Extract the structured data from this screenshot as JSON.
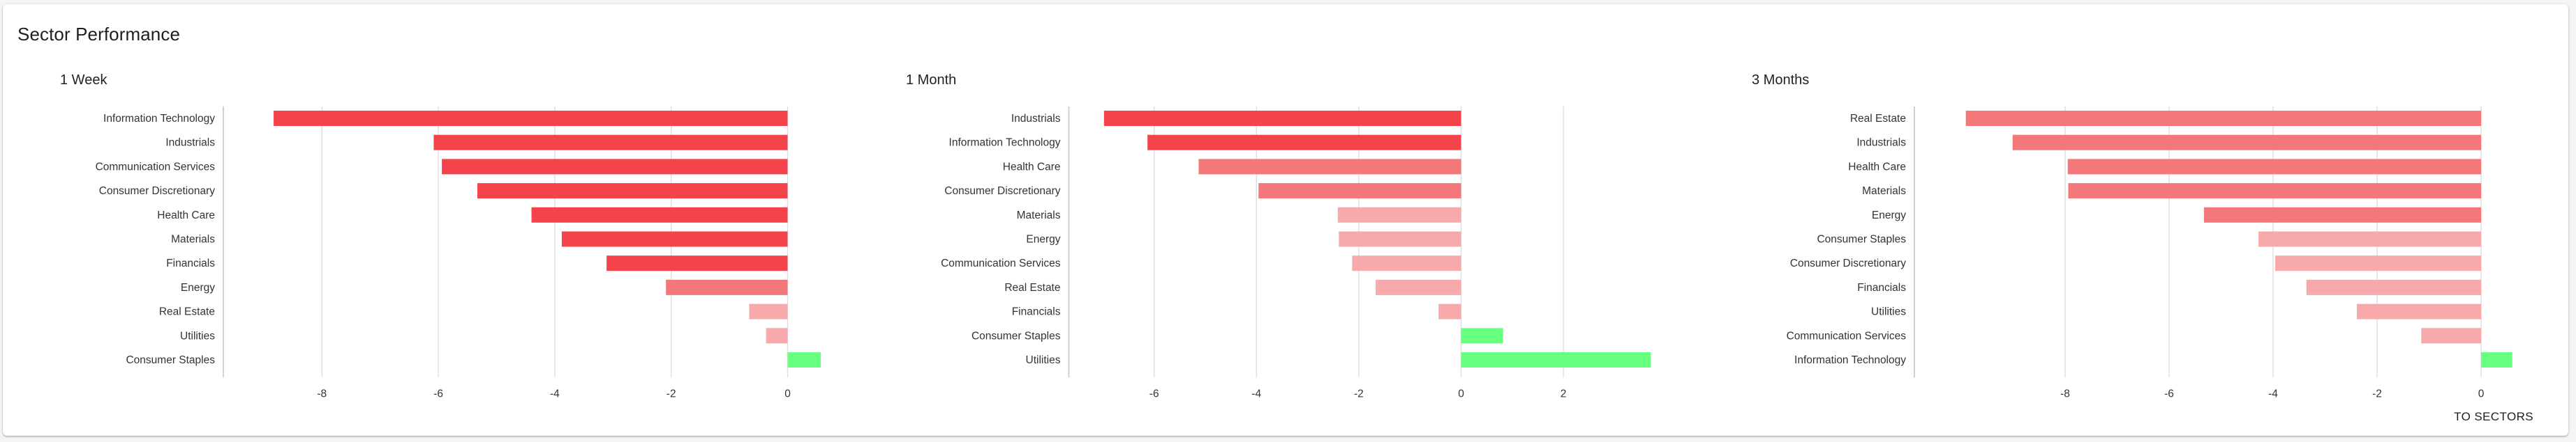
{
  "card": {
    "title": "Sector Performance",
    "footer_link": "TO SECTORS"
  },
  "colors": {
    "strong_negative": "#f4434b",
    "medium_negative": "#f4777a",
    "light_negative": "#f7a9ac",
    "positive": "#66ff80",
    "gridline": "#dcdce2",
    "axis": "#cfd0dc"
  },
  "chart_data": [
    {
      "type": "bar",
      "orientation": "horizontal",
      "title": "1 Week",
      "xlabel": "",
      "ylabel": "",
      "xlim": [
        -9.5,
        0.8
      ],
      "xticks": [
        -8,
        -6,
        -4,
        -2,
        0
      ],
      "grid": true,
      "categories": [
        "Information Technology",
        "Industrials",
        "Communication Services",
        "Consumer Discretionary",
        "Health Care",
        "Materials",
        "Financials",
        "Energy",
        "Real Estate",
        "Utilities",
        "Consumer Staples"
      ],
      "values": [
        -8.83,
        -6.08,
        -5.94,
        -5.33,
        -4.4,
        -3.88,
        -3.11,
        -2.09,
        -0.66,
        -0.37,
        0.57
      ],
      "color_keys": [
        "strong_negative",
        "strong_negative",
        "strong_negative",
        "strong_negative",
        "strong_negative",
        "strong_negative",
        "strong_negative",
        "medium_negative",
        "light_negative",
        "light_negative",
        "positive"
      ]
    },
    {
      "type": "bar",
      "orientation": "horizontal",
      "title": "1 Month",
      "xlabel": "",
      "ylabel": "",
      "xlim": [
        -7.7,
        3.9
      ],
      "xticks": [
        -6,
        -4,
        -2,
        0,
        2
      ],
      "grid": true,
      "categories": [
        "Industrials",
        "Information Technology",
        "Health Care",
        "Consumer Discretionary",
        "Materials",
        "Energy",
        "Communication Services",
        "Real Estate",
        "Financials",
        "Consumer Staples",
        "Utilities"
      ],
      "values": [
        -6.98,
        -6.13,
        -5.13,
        -3.96,
        -2.41,
        -2.39,
        -2.13,
        -1.67,
        -0.44,
        0.82,
        3.71
      ],
      "color_keys": [
        "strong_negative",
        "strong_negative",
        "medium_negative",
        "medium_negative",
        "light_negative",
        "light_negative",
        "light_negative",
        "light_negative",
        "light_negative",
        "positive",
        "positive"
      ]
    },
    {
      "type": "bar",
      "orientation": "horizontal",
      "title": "3 Months",
      "xlabel": "",
      "ylabel": "",
      "xlim": [
        -10.9,
        0.8
      ],
      "xticks": [
        -8,
        -6,
        -4,
        -2,
        0
      ],
      "grid": true,
      "categories": [
        "Real Estate",
        "Industrials",
        "Health Care",
        "Materials",
        "Energy",
        "Consumer Staples",
        "Consumer Discretionary",
        "Financials",
        "Utilities",
        "Communication Services",
        "Information Technology"
      ],
      "values": [
        -9.91,
        -9.01,
        -7.95,
        -7.94,
        -5.33,
        -4.28,
        -3.96,
        -3.36,
        -2.39,
        -1.15,
        0.6
      ],
      "color_keys": [
        "medium_negative",
        "medium_negative",
        "medium_negative",
        "medium_negative",
        "medium_negative",
        "light_negative",
        "light_negative",
        "light_negative",
        "light_negative",
        "light_negative",
        "positive"
      ]
    }
  ]
}
